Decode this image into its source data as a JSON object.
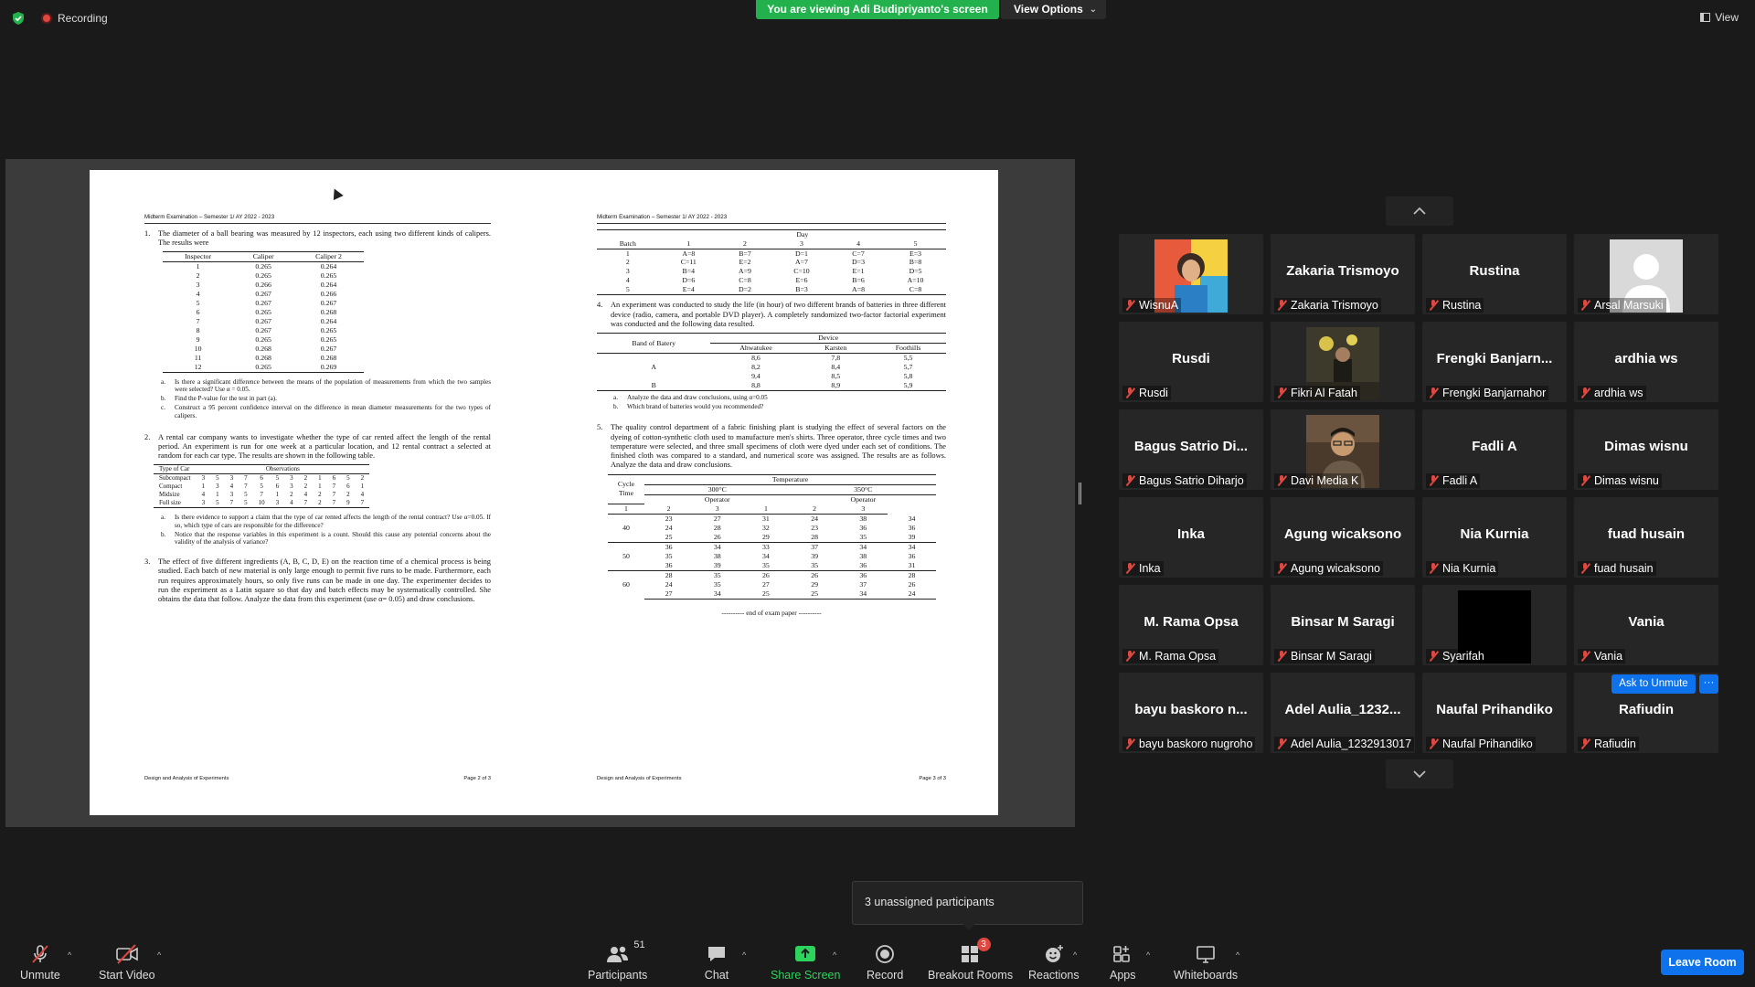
{
  "topbar": {
    "recording_label": "Recording",
    "viewing_banner": "You are viewing Adi Budipriyanto's screen",
    "view_options": "View Options",
    "view_label": "View"
  },
  "exam": {
    "left": {
      "header": "Midterm Examination – Semester 1/ AY 2022 - 2023",
      "q1": {
        "num": "1.",
        "text": "The diameter of a ball bearing was measured by 12 inspectors, each using two different kinds of calipers. The results were",
        "table": {
          "headers": [
            "Inspector",
            "Caliper",
            "Caliper 2"
          ],
          "rows": [
            [
              "1",
              "0.265",
              "0.264"
            ],
            [
              "2",
              "0.265",
              "0.265"
            ],
            [
              "3",
              "0.266",
              "0.264"
            ],
            [
              "4",
              "0.267",
              "0.266"
            ],
            [
              "5",
              "0.267",
              "0.267"
            ],
            [
              "6",
              "0.265",
              "0.268"
            ],
            [
              "7",
              "0.267",
              "0.264"
            ],
            [
              "8",
              "0.267",
              "0.265"
            ],
            [
              "9",
              "0.265",
              "0.265"
            ],
            [
              "10",
              "0.268",
              "0.267"
            ],
            [
              "11",
              "0.268",
              "0.268"
            ],
            [
              "12",
              "0.265",
              "0.269"
            ]
          ]
        },
        "subs": [
          {
            "n": "a.",
            "t": "Is there a significant difference between the means of the population of measurements from which the two samples were selected? Use α = 0.05."
          },
          {
            "n": "b.",
            "t": "Find the P-value for the test in part (a)."
          },
          {
            "n": "c.",
            "t": "Construct a 95 percent confidence interval on the difference in mean diameter measurements for the two types of calipers."
          }
        ]
      },
      "q2": {
        "num": "2.",
        "text": "A rental car company wants to investigate whether the type of car rented affect the length of the rental period. An experiment is run for one week at a particular location, and 12 rental contract a selected at random for each car type. The results are shown in the following table.",
        "table": {
          "headers": [
            "Type of Car",
            "Observations"
          ],
          "rows": [
            [
              "Subcompact",
              "3",
              "5",
              "3",
              "7",
              "6",
              "5",
              "3",
              "2",
              "1",
              "6",
              "5",
              "2"
            ],
            [
              "Compact",
              "1",
              "3",
              "4",
              "7",
              "5",
              "6",
              "3",
              "2",
              "1",
              "7",
              "6",
              "1"
            ],
            [
              "Midsize",
              "4",
              "1",
              "3",
              "5",
              "7",
              "1",
              "2",
              "4",
              "2",
              "7",
              "2",
              "4"
            ],
            [
              "Full size",
              "3",
              "5",
              "7",
              "5",
              "10",
              "3",
              "4",
              "7",
              "2",
              "7",
              "9",
              "7"
            ]
          ]
        },
        "subs": [
          {
            "n": "a.",
            "t": "Is there evidence to support a claim that the type of car rented affects the length of the rental contract? Use α=0.05. If so, which type of cars are responsible for the difference?"
          },
          {
            "n": "b.",
            "t": "Notice that the response variables in this experiment is a count. Should this cause any potential concerns about the validity of the analysis of variance?"
          }
        ]
      },
      "q3": {
        "num": "3.",
        "text": "The effect of five different ingredients (A, B, C, D, E) on the reaction time of a chemical process is being studied. Each batch of new material is only large enough to permit five runs to be made. Furthermore, each run requires approximately hours, so only five runs can be made in one day. The experimenter decides to run the experiment as a Latin square so that day and batch effects may be systematically controlled. She obtains the data that follow. Analyze the data from this experiment (use α= 0.05) and draw conclusions."
      },
      "footer_left": "Design and Analysis of Experiments",
      "footer_right": "Page 2 of 3"
    },
    "right": {
      "header": "Midterm Examination – Semester 1/ AY 2022 - 2023",
      "latin": {
        "day_label": "Day",
        "headers": [
          "Batch",
          "1",
          "2",
          "3",
          "4",
          "5"
        ],
        "rows": [
          [
            "1",
            "A=8",
            "B=7",
            "D=1",
            "C=7",
            "E=3"
          ],
          [
            "2",
            "C=11",
            "E=2",
            "A=7",
            "D=3",
            "B=8"
          ],
          [
            "3",
            "B=4",
            "A=9",
            "C=10",
            "E=1",
            "D=5"
          ],
          [
            "4",
            "D=6",
            "C=8",
            "E=6",
            "B=6",
            "A=10"
          ],
          [
            "5",
            "E=4",
            "D=2",
            "B=3",
            "A=8",
            "C=8"
          ]
        ]
      },
      "q4": {
        "num": "4.",
        "text": "An experiment was conducted to study the life (in hour) of two different brands of batteries in three different device (radio, camera, and portable DVD player). A completely randomized two-factor factorial experiment was conducted and the following data resulted.",
        "table": {
          "row_header": "Band of Batery",
          "group_header": "Device",
          "cols": [
            "Ahwatukee",
            "Karsten",
            "Foothills"
          ],
          "rows": [
            [
              "",
              "8,6",
              "7,8",
              "5,5"
            ],
            [
              "A",
              "8,2",
              "8,4",
              "5,7"
            ],
            [
              "",
              "9,4",
              "8,5",
              "5,8"
            ],
            [
              "B",
              "8,8",
              "8,9",
              "5,9"
            ]
          ]
        },
        "subs": [
          {
            "n": "a.",
            "t": "Analyze the data and draw conclusions, using α=0.05"
          },
          {
            "n": "b.",
            "t": "Which brand of batteries would you recommended?"
          }
        ]
      },
      "q5": {
        "num": "5.",
        "text": "The quality control department of a fabric finishing plant is studying the effect of several factors on the dyeing of cotton-synthetic cloth used to manufacture men's shirts. Three operator, three cycle times and two temperature were selected, and three small specimens of cloth were dyed under each set of conditions. The finished cloth was compared to a standard, and numerical score was assigned. The results are as follows. Analyze the data and draw conclusions.",
        "table": {
          "cycle_label": "Cycle Time",
          "temp_label": "Temperature",
          "temps": [
            "300°C",
            "350°C"
          ],
          "operator_label": "Operator",
          "ops": [
            "1",
            "2",
            "3",
            "1",
            "2",
            "3"
          ],
          "groups": [
            {
              "cycle": "40",
              "rows": [
                [
                  "23",
                  "27",
                  "31",
                  "24",
                  "38",
                  "34"
                ],
                [
                  "24",
                  "28",
                  "32",
                  "23",
                  "36",
                  "36"
                ],
                [
                  "25",
                  "26",
                  "29",
                  "28",
                  "35",
                  "39"
                ]
              ]
            },
            {
              "cycle": "50",
              "rows": [
                [
                  "36",
                  "34",
                  "33",
                  "37",
                  "34",
                  "34"
                ],
                [
                  "35",
                  "38",
                  "34",
                  "39",
                  "38",
                  "36"
                ],
                [
                  "36",
                  "39",
                  "35",
                  "35",
                  "36",
                  "31"
                ]
              ]
            },
            {
              "cycle": "60",
              "rows": [
                [
                  "28",
                  "35",
                  "26",
                  "26",
                  "36",
                  "28"
                ],
                [
                  "24",
                  "35",
                  "27",
                  "29",
                  "37",
                  "26"
                ],
                [
                  "27",
                  "34",
                  "25",
                  "25",
                  "34",
                  "24"
                ]
              ]
            }
          ]
        }
      },
      "end_text": "---------- end of exam paper ----------",
      "footer_left": "Design and Analysis of Experiments",
      "footer_right": "Page 3 of 3"
    }
  },
  "participants": [
    {
      "big": "",
      "label": "WisnuA"
    },
    {
      "big": "Zakaria Trismoyo",
      "label": "Zakaria Trismoyo"
    },
    {
      "big": "Rustina",
      "label": "Rustina"
    },
    {
      "big": "",
      "label": "Arsal Marsuki"
    },
    {
      "big": "Rusdi",
      "label": "Rusdi"
    },
    {
      "big": "",
      "label": "Fikri Al Fatah"
    },
    {
      "big": "Frengki  Banjarn...",
      "label": "Frengki Banjarnahor"
    },
    {
      "big": "ardhia ws",
      "label": "ardhia ws"
    },
    {
      "big": "Bagus Satrio Di...",
      "label": "Bagus Satrio Diharjo"
    },
    {
      "big": "",
      "label": "Davi Media K"
    },
    {
      "big": "Fadli A",
      "label": "Fadli A"
    },
    {
      "big": "Dimas wisnu",
      "label": "Dimas wisnu"
    },
    {
      "big": "Inka",
      "label": "Inka"
    },
    {
      "big": "Agung wicaksono",
      "label": "Agung wicaksono"
    },
    {
      "big": "Nia Kurnia",
      "label": "Nia Kurnia"
    },
    {
      "big": "fuad husain",
      "label": "fuad husain"
    },
    {
      "big": "M. Rama Opsa",
      "label": "M. Rama Opsa"
    },
    {
      "big": "Binsar M Saragi",
      "label": "Binsar M Saragi"
    },
    {
      "big": "",
      "label": "Syarifah"
    },
    {
      "big": "Vania",
      "label": "Vania"
    },
    {
      "big": "bayu baskoro n...",
      "label": "bayu baskoro nugroho"
    },
    {
      "big": "Adel Aulia_1232...",
      "label": "Adel Aulia_1232913017"
    },
    {
      "big": "Naufal Prihandiko",
      "label": "Naufal Prihandiko"
    },
    {
      "big": "Rafiudin",
      "label": "Rafiudin"
    }
  ],
  "ask_unmute": "Ask to Unmute",
  "more_label": "···",
  "tooltip": "3 unassigned participants",
  "toolbar": {
    "unmute": "Unmute",
    "start_video": "Start Video",
    "participants": "Participants",
    "participants_count": "51",
    "chat": "Chat",
    "share_screen": "Share Screen",
    "record": "Record",
    "breakout_rooms": "Breakout Rooms",
    "breakout_badge": "3",
    "reactions": "Reactions",
    "apps": "Apps",
    "whiteboards": "Whiteboards",
    "leave_room": "Leave Room"
  },
  "colors": {
    "accent_blue": "#0e72ed",
    "share_green": "#23b14d",
    "muted_red": "#e0473e",
    "tile_bg": "#262626"
  }
}
